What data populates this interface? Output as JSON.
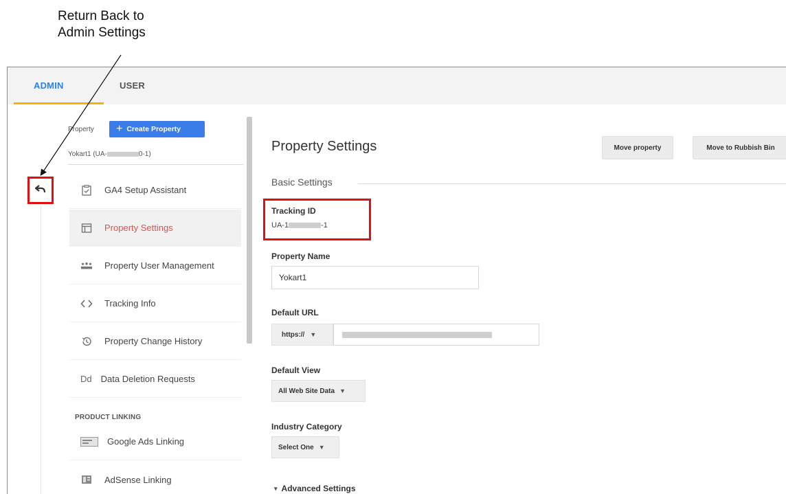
{
  "annotation": {
    "line1": "Return Back to",
    "line2": "Admin Settings"
  },
  "tabs": [
    {
      "label": "ADMIN",
      "active": true
    },
    {
      "label": "USER",
      "active": false
    }
  ],
  "colors": {
    "accent_blue": "#3a7de8",
    "tab_underline": "#f5b400",
    "active_red": "#d9534f",
    "highlight_red": "#e01010"
  },
  "property": {
    "label": "Property",
    "create_button": "Create Property",
    "selected": "Yokart1 (UA-",
    "selected_suffix": "0-1)"
  },
  "nav": {
    "items": [
      {
        "label": "GA4 Setup Assistant",
        "icon": "checklist-icon"
      },
      {
        "label": "Property Settings",
        "icon": "window-icon",
        "active": true
      },
      {
        "label": "Property User Management",
        "icon": "people-icon"
      },
      {
        "label": "Tracking Info",
        "icon": "code-icon"
      },
      {
        "label": "Property Change History",
        "icon": "history-icon"
      },
      {
        "label": "Data Deletion Requests",
        "icon": "dd-icon"
      }
    ],
    "section_product_linking": "PRODUCT LINKING",
    "linking_items": [
      {
        "label": "Google Ads Linking",
        "icon": "ads-icon"
      },
      {
        "label": "AdSense Linking",
        "icon": "adsense-icon"
      }
    ],
    "dd_glyph": "Dd"
  },
  "main": {
    "title": "Property Settings",
    "move_property": "Move property",
    "move_rubbish": "Move to Rubbish Bin",
    "basic_settings": "Basic Settings",
    "tracking_id_label": "Tracking ID",
    "tracking_id_prefix": "UA-1",
    "tracking_id_suffix": "-1",
    "property_name_label": "Property Name",
    "property_name_value": "Yokart1",
    "default_url_label": "Default URL",
    "url_protocol": "https://",
    "default_view_label": "Default View",
    "default_view_value": "All Web Site Data",
    "industry_label": "Industry Category",
    "industry_value": "Select One",
    "advanced_settings": "Advanced Settings"
  }
}
